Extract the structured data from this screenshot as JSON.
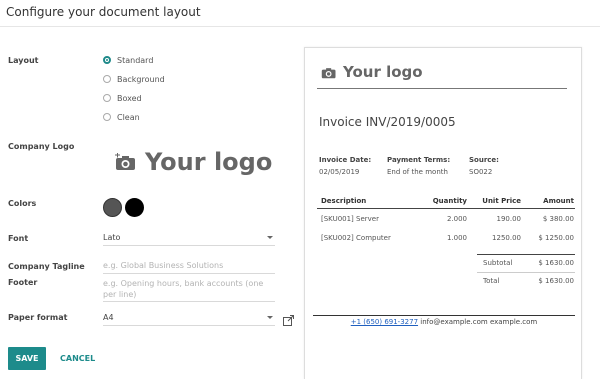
{
  "dialog": {
    "title": "Configure your document layout"
  },
  "labels": {
    "layout": "Layout",
    "company_logo": "Company Logo",
    "colors": "Colors",
    "font": "Font",
    "company_tagline": "Company Tagline",
    "footer": "Footer",
    "paper_format": "Paper format"
  },
  "layout_options": [
    {
      "label": "Standard",
      "checked": true
    },
    {
      "label": "Background",
      "checked": false
    },
    {
      "label": "Boxed",
      "checked": false
    },
    {
      "label": "Clean",
      "checked": false
    }
  ],
  "logo_text": "Your logo",
  "colors": {
    "primary": "#555555",
    "secondary": "#000000",
    "accent": "#1d8b8b"
  },
  "fields": {
    "font_value": "Lato",
    "tagline_placeholder": "e.g. Global Business Solutions",
    "footer_placeholder_line1": "e.g. Opening hours, bank accounts (one",
    "footer_placeholder_line2": "per line)",
    "paper_format_value": "A4"
  },
  "buttons": {
    "save": "SAVE",
    "cancel": "CANCEL"
  },
  "preview": {
    "logo_text": "Your logo",
    "invoice_title": "Invoice INV/2019/0005",
    "meta": [
      {
        "label": "Invoice Date:",
        "value": "02/05/2019"
      },
      {
        "label": "Payment Terms:",
        "value": "End of the month"
      },
      {
        "label": "Source:",
        "value": "SO022"
      }
    ],
    "table_headers": [
      "Description",
      "Quantity",
      "Unit Price",
      "Amount"
    ],
    "rows": [
      [
        "[SKU001] Server",
        "2.000",
        "190.00",
        "$ 380.00"
      ],
      [
        "[SKU002] Computer",
        "1.000",
        "1250.00",
        "$ 1250.00"
      ]
    ],
    "subtotal_label": "Subtotal",
    "subtotal_value": "$ 1630.00",
    "total_label": "Total",
    "total_value": "$ 1630.00",
    "footer_phone": "+1 (650) 691-3277",
    "footer_email": "info@example.com",
    "footer_site": "example.com"
  }
}
